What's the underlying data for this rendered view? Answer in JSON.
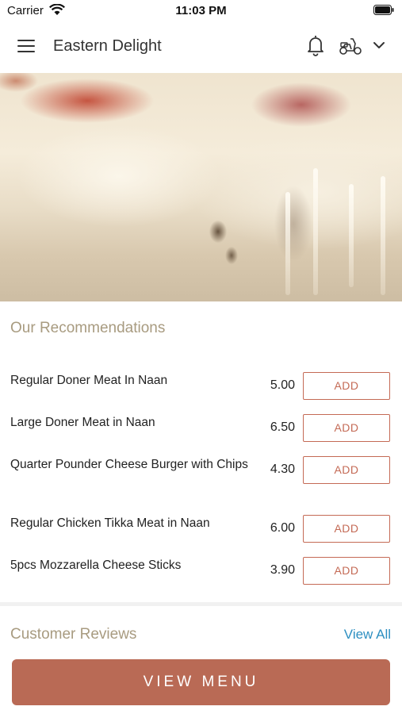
{
  "status_bar": {
    "carrier": "Carrier",
    "time": "11:03 PM"
  },
  "header": {
    "title": "Eastern Delight",
    "icons": [
      "menu-icon",
      "bell-icon",
      "scooter-icon",
      "chevron-down-icon"
    ]
  },
  "hero": {
    "image": "pizza-cheese-pull"
  },
  "recommendations": {
    "title": "Our Recommendations",
    "items": [
      {
        "name": "Regular Doner Meat In Naan",
        "price": "5.00",
        "button": "ADD"
      },
      {
        "name": "Large Doner Meat in Naan",
        "price": "6.50",
        "button": "ADD"
      },
      {
        "name": "Quarter Pounder Cheese Burger with Chips",
        "price": "4.30",
        "button": "ADD"
      },
      {
        "name": "Regular Chicken Tikka Meat in Naan",
        "price": "6.00",
        "button": "ADD"
      },
      {
        "name": "5pcs Mozzarella Cheese Sticks",
        "price": "3.90",
        "button": "ADD"
      }
    ]
  },
  "reviews": {
    "title": "Customer Reviews",
    "view_all": "View All"
  },
  "footer": {
    "button": "VIEW MENU"
  },
  "colors": {
    "accent": "#b96a55",
    "section_title": "#a89b80",
    "link": "#2d8fc1"
  }
}
